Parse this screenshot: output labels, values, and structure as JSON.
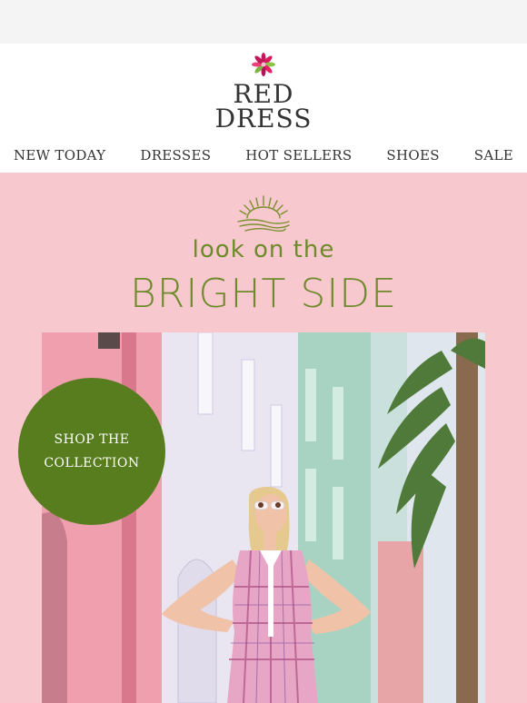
{
  "brand": {
    "line1": "RED",
    "line2": "DRESS"
  },
  "nav": [
    {
      "label": "NEW TODAY"
    },
    {
      "label": "DRESSES"
    },
    {
      "label": "HOT SELLERS"
    },
    {
      "label": "SHOES"
    },
    {
      "label": "SALE"
    }
  ],
  "hero": {
    "line1": "look on the",
    "line2": "BRIGHT SIDE",
    "cta_line1": "SHOP THE",
    "cta_line2": "COLLECTION"
  },
  "colors": {
    "accent_green": "#577d1f",
    "headline_green": "#6e8a2c",
    "hero_pink": "#f8c8cf"
  }
}
